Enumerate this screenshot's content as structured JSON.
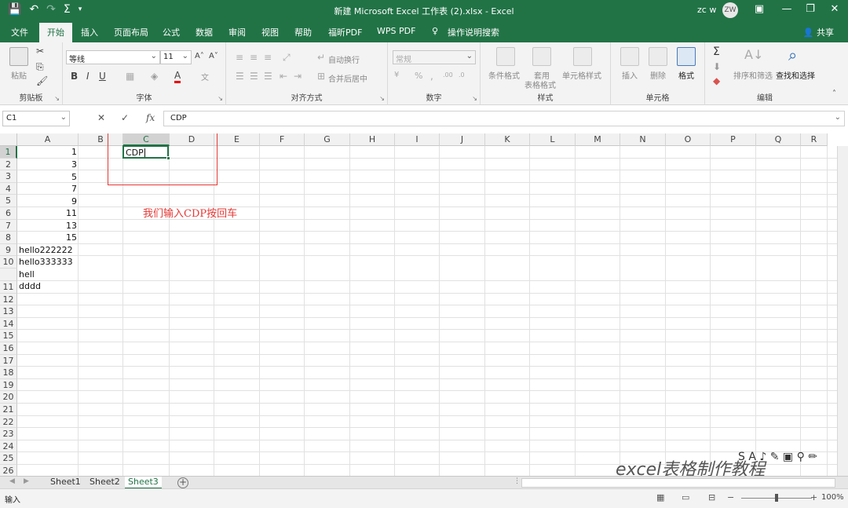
{
  "window": {
    "title": "新建 Microsoft Excel 工作表 (2).xlsx  -  Excel",
    "user": "zc w",
    "avatar": "ZW"
  },
  "tabs": [
    "文件",
    "开始",
    "插入",
    "页面布局",
    "公式",
    "数据",
    "审阅",
    "视图",
    "帮助",
    "福昕PDF",
    "WPS PDF",
    "操作说明搜索"
  ],
  "active_tab": "开始",
  "share": "共享",
  "ribbon": {
    "clipboard": {
      "label": "剪贴板",
      "paste": "粘贴"
    },
    "font": {
      "label": "字体",
      "name": "等线",
      "size": "11"
    },
    "align": {
      "label": "对齐方式",
      "wrap": "自动换行",
      "merge": "合并后居中"
    },
    "number": {
      "label": "数字",
      "format": "常规"
    },
    "styles": {
      "label": "样式",
      "cond": "条件格式",
      "table1": "套用",
      "table2": "表格格式",
      "cell": "单元格样式"
    },
    "cells": {
      "label": "单元格",
      "insert": "插入",
      "delete": "删除",
      "format": "格式"
    },
    "editing": {
      "label": "编辑",
      "sort": "排序和筛选",
      "find": "查找和选择"
    }
  },
  "formula_bar": {
    "name_box": "C1",
    "content": "CDP",
    "fx": "fx"
  },
  "columns": [
    "A",
    "B",
    "C",
    "D",
    "E",
    "F",
    "G",
    "H",
    "I",
    "J",
    "K",
    "L",
    "M",
    "N",
    "O",
    "P",
    "Q",
    "R"
  ],
  "rows": [
    "1",
    "2",
    "3",
    "4",
    "5",
    "6",
    "7",
    "8",
    "9",
    "10",
    "",
    "11",
    "12",
    "13",
    "14",
    "15",
    "16",
    "17",
    "18",
    "19",
    "20",
    "21",
    "22",
    "23",
    "24",
    "25",
    "26"
  ],
  "cells": {
    "a1": "1",
    "a2": "3",
    "a3": "5",
    "a4": "7",
    "a5": "9",
    "a6": "11",
    "a7": "13",
    "a8": "15",
    "a9": "hello222222",
    "a10": "hello333333",
    "a10b": "hell",
    "a11": "dddd",
    "c1": "CDP"
  },
  "annotation": "我们输入CDP按回车",
  "sheets": [
    "Sheet1",
    "Sheet2",
    "Sheet3"
  ],
  "active_sheet": "Sheet3",
  "status": {
    "mode": "输入",
    "zoom": "100%"
  },
  "watermark": "excel表格制作教程"
}
